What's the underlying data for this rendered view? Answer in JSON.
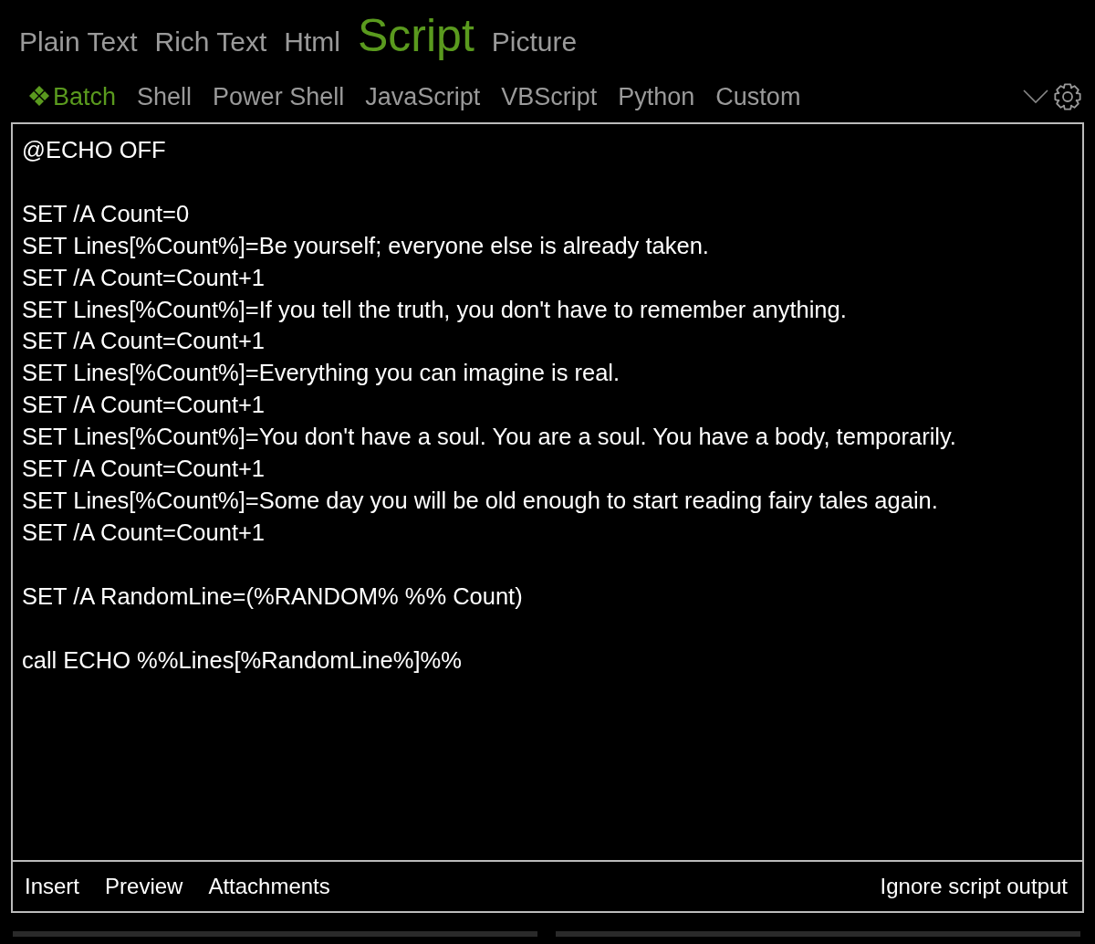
{
  "format_tabs": [
    {
      "label": "Plain Text",
      "selected": false
    },
    {
      "label": "Rich Text",
      "selected": false
    },
    {
      "label": "Html",
      "selected": false
    },
    {
      "label": "Script",
      "selected": true
    },
    {
      "label": "Picture",
      "selected": false
    }
  ],
  "script_tabs": [
    {
      "label": "Batch",
      "selected": true
    },
    {
      "label": "Shell",
      "selected": false
    },
    {
      "label": "Power Shell",
      "selected": false
    },
    {
      "label": "JavaScript",
      "selected": false
    },
    {
      "label": "VBScript",
      "selected": false
    },
    {
      "label": "Python",
      "selected": false
    },
    {
      "label": "Custom",
      "selected": false
    }
  ],
  "editor": {
    "text": "@ECHO OFF\n\nSET /A Count=0\nSET Lines[%Count%]=Be yourself; everyone else is already taken.\nSET /A Count=Count+1\nSET Lines[%Count%]=If you tell the truth, you don't have to remember anything.\nSET /A Count=Count+1\nSET Lines[%Count%]=Everything you can imagine is real.\nSET /A Count=Count+1\nSET Lines[%Count%]=You don't have a soul. You are a soul. You have a body, temporarily.\nSET /A Count=Count+1\nSET Lines[%Count%]=Some day you will be old enough to start reading fairy tales again.\nSET /A Count=Count+1\n\nSET /A RandomLine=(%RANDOM% %% Count)\n\ncall ECHO %%Lines[%RandomLine%]%%"
  },
  "footer": {
    "actions": [
      "Insert",
      "Preview",
      "Attachments"
    ],
    "option": "Ignore script output"
  }
}
